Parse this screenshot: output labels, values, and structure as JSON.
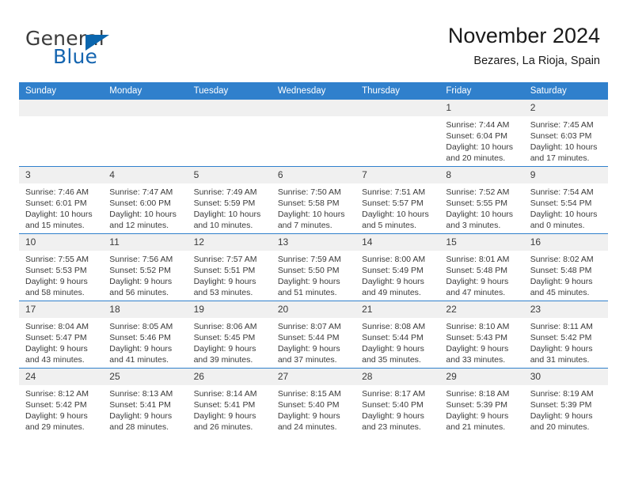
{
  "brand": {
    "word1": "General",
    "word2": "Blue",
    "accent_color": "#0a66ae"
  },
  "header": {
    "title": "November 2024",
    "subtitle": "Bezares, La Rioja, Spain"
  },
  "calendar": {
    "header_color": "#3080cc",
    "daynum_band_color": "#f0f0f0",
    "weekday_headers": [
      "Sunday",
      "Monday",
      "Tuesday",
      "Wednesday",
      "Thursday",
      "Friday",
      "Saturday"
    ],
    "weeks": [
      [
        {
          "day": "",
          "lines": []
        },
        {
          "day": "",
          "lines": []
        },
        {
          "day": "",
          "lines": []
        },
        {
          "day": "",
          "lines": []
        },
        {
          "day": "",
          "lines": []
        },
        {
          "day": "1",
          "lines": [
            "Sunrise: 7:44 AM",
            "Sunset: 6:04 PM",
            "Daylight: 10 hours",
            "and 20 minutes."
          ]
        },
        {
          "day": "2",
          "lines": [
            "Sunrise: 7:45 AM",
            "Sunset: 6:03 PM",
            "Daylight: 10 hours",
            "and 17 minutes."
          ]
        }
      ],
      [
        {
          "day": "3",
          "lines": [
            "Sunrise: 7:46 AM",
            "Sunset: 6:01 PM",
            "Daylight: 10 hours",
            "and 15 minutes."
          ]
        },
        {
          "day": "4",
          "lines": [
            "Sunrise: 7:47 AM",
            "Sunset: 6:00 PM",
            "Daylight: 10 hours",
            "and 12 minutes."
          ]
        },
        {
          "day": "5",
          "lines": [
            "Sunrise: 7:49 AM",
            "Sunset: 5:59 PM",
            "Daylight: 10 hours",
            "and 10 minutes."
          ]
        },
        {
          "day": "6",
          "lines": [
            "Sunrise: 7:50 AM",
            "Sunset: 5:58 PM",
            "Daylight: 10 hours",
            "and 7 minutes."
          ]
        },
        {
          "day": "7",
          "lines": [
            "Sunrise: 7:51 AM",
            "Sunset: 5:57 PM",
            "Daylight: 10 hours",
            "and 5 minutes."
          ]
        },
        {
          "day": "8",
          "lines": [
            "Sunrise: 7:52 AM",
            "Sunset: 5:55 PM",
            "Daylight: 10 hours",
            "and 3 minutes."
          ]
        },
        {
          "day": "9",
          "lines": [
            "Sunrise: 7:54 AM",
            "Sunset: 5:54 PM",
            "Daylight: 10 hours",
            "and 0 minutes."
          ]
        }
      ],
      [
        {
          "day": "10",
          "lines": [
            "Sunrise: 7:55 AM",
            "Sunset: 5:53 PM",
            "Daylight: 9 hours",
            "and 58 minutes."
          ]
        },
        {
          "day": "11",
          "lines": [
            "Sunrise: 7:56 AM",
            "Sunset: 5:52 PM",
            "Daylight: 9 hours",
            "and 56 minutes."
          ]
        },
        {
          "day": "12",
          "lines": [
            "Sunrise: 7:57 AM",
            "Sunset: 5:51 PM",
            "Daylight: 9 hours",
            "and 53 minutes."
          ]
        },
        {
          "day": "13",
          "lines": [
            "Sunrise: 7:59 AM",
            "Sunset: 5:50 PM",
            "Daylight: 9 hours",
            "and 51 minutes."
          ]
        },
        {
          "day": "14",
          "lines": [
            "Sunrise: 8:00 AM",
            "Sunset: 5:49 PM",
            "Daylight: 9 hours",
            "and 49 minutes."
          ]
        },
        {
          "day": "15",
          "lines": [
            "Sunrise: 8:01 AM",
            "Sunset: 5:48 PM",
            "Daylight: 9 hours",
            "and 47 minutes."
          ]
        },
        {
          "day": "16",
          "lines": [
            "Sunrise: 8:02 AM",
            "Sunset: 5:48 PM",
            "Daylight: 9 hours",
            "and 45 minutes."
          ]
        }
      ],
      [
        {
          "day": "17",
          "lines": [
            "Sunrise: 8:04 AM",
            "Sunset: 5:47 PM",
            "Daylight: 9 hours",
            "and 43 minutes."
          ]
        },
        {
          "day": "18",
          "lines": [
            "Sunrise: 8:05 AM",
            "Sunset: 5:46 PM",
            "Daylight: 9 hours",
            "and 41 minutes."
          ]
        },
        {
          "day": "19",
          "lines": [
            "Sunrise: 8:06 AM",
            "Sunset: 5:45 PM",
            "Daylight: 9 hours",
            "and 39 minutes."
          ]
        },
        {
          "day": "20",
          "lines": [
            "Sunrise: 8:07 AM",
            "Sunset: 5:44 PM",
            "Daylight: 9 hours",
            "and 37 minutes."
          ]
        },
        {
          "day": "21",
          "lines": [
            "Sunrise: 8:08 AM",
            "Sunset: 5:44 PM",
            "Daylight: 9 hours",
            "and 35 minutes."
          ]
        },
        {
          "day": "22",
          "lines": [
            "Sunrise: 8:10 AM",
            "Sunset: 5:43 PM",
            "Daylight: 9 hours",
            "and 33 minutes."
          ]
        },
        {
          "day": "23",
          "lines": [
            "Sunrise: 8:11 AM",
            "Sunset: 5:42 PM",
            "Daylight: 9 hours",
            "and 31 minutes."
          ]
        }
      ],
      [
        {
          "day": "24",
          "lines": [
            "Sunrise: 8:12 AM",
            "Sunset: 5:42 PM",
            "Daylight: 9 hours",
            "and 29 minutes."
          ]
        },
        {
          "day": "25",
          "lines": [
            "Sunrise: 8:13 AM",
            "Sunset: 5:41 PM",
            "Daylight: 9 hours",
            "and 28 minutes."
          ]
        },
        {
          "day": "26",
          "lines": [
            "Sunrise: 8:14 AM",
            "Sunset: 5:41 PM",
            "Daylight: 9 hours",
            "and 26 minutes."
          ]
        },
        {
          "day": "27",
          "lines": [
            "Sunrise: 8:15 AM",
            "Sunset: 5:40 PM",
            "Daylight: 9 hours",
            "and 24 minutes."
          ]
        },
        {
          "day": "28",
          "lines": [
            "Sunrise: 8:17 AM",
            "Sunset: 5:40 PM",
            "Daylight: 9 hours",
            "and 23 minutes."
          ]
        },
        {
          "day": "29",
          "lines": [
            "Sunrise: 8:18 AM",
            "Sunset: 5:39 PM",
            "Daylight: 9 hours",
            "and 21 minutes."
          ]
        },
        {
          "day": "30",
          "lines": [
            "Sunrise: 8:19 AM",
            "Sunset: 5:39 PM",
            "Daylight: 9 hours",
            "and 20 minutes."
          ]
        }
      ]
    ]
  }
}
